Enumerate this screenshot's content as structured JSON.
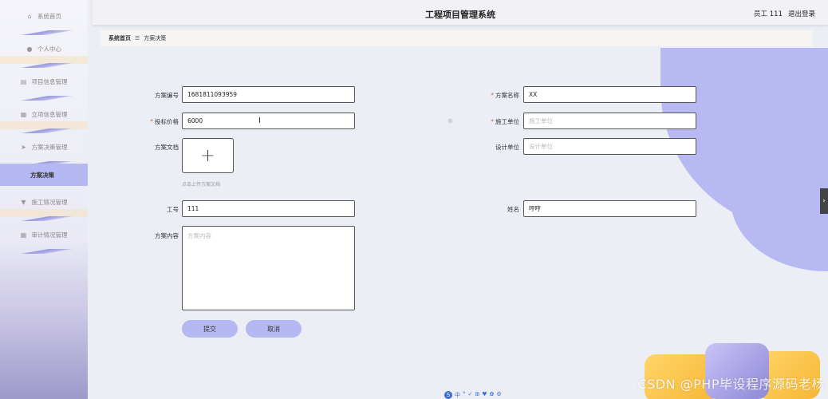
{
  "app": {
    "title": "工程项目管理系统",
    "user_label": "员工 111",
    "logout_label": "退出登录"
  },
  "sidebar": {
    "items": [
      {
        "label": "系统首页",
        "icon": "home-icon"
      },
      {
        "label": "个人中心",
        "icon": "user-icon"
      },
      {
        "label": "项目信息管理",
        "icon": "clipboard-icon"
      },
      {
        "label": "立项信息管理",
        "icon": "grid-icon"
      },
      {
        "label": "方案决策管理",
        "icon": "send-icon"
      },
      {
        "label": "方案决策",
        "icon": ""
      },
      {
        "label": "施工情况管理",
        "icon": "hammer-icon"
      },
      {
        "label": "审计情况管理",
        "icon": "grid-icon"
      }
    ]
  },
  "breadcrumb": {
    "home": "系统首页",
    "separator": "☰",
    "current": "方案决策"
  },
  "form": {
    "plan_no": {
      "label": "方案编号",
      "value": "1681811093959"
    },
    "plan_name": {
      "label": "方案名称",
      "value": "XX",
      "required": "*"
    },
    "bid_price": {
      "label": "投标价格",
      "value": "6000",
      "required": "*"
    },
    "construction_unit": {
      "label": "施工单位",
      "placeholder": "施工单位",
      "required": "*"
    },
    "plan_document": {
      "label": "方案文档",
      "hint": "点击上传方案文档",
      "plus": "+"
    },
    "design_unit": {
      "label": "设计单位",
      "placeholder": "设计单位"
    },
    "employee_no": {
      "label": "工号",
      "value": "111"
    },
    "name": {
      "label": "姓名",
      "value": "哼哼"
    },
    "plan_content": {
      "label": "方案内容",
      "placeholder": "方案内容"
    },
    "submit_label": "提交",
    "cancel_label": "取消"
  },
  "watermark": "CSDN @PHP毕设程序源码老杨",
  "ime": [
    "S",
    "中",
    "°",
    "✓",
    "⊞",
    "♥",
    "✿",
    "⚙"
  ],
  "colors": {
    "accent": "#b6b8f4",
    "blob": "#b8b9f2",
    "required": "#e55555"
  }
}
